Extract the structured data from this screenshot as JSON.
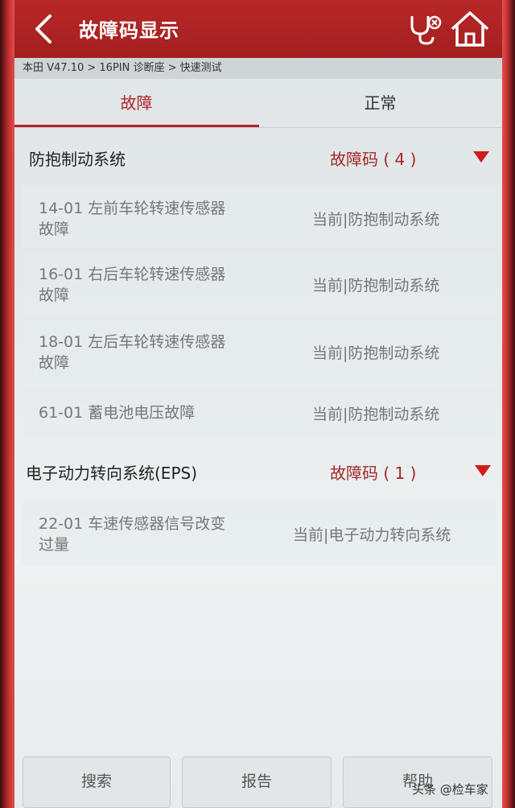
{
  "header": {
    "title": "故障码显示",
    "back_icon": "chevron-left-icon",
    "stethoscope_icon": "stethoscope-icon",
    "home_icon": "home-icon"
  },
  "breadcrumb": "本田 V47.10 > 16PIN 诊断座 > 快速测试",
  "tabs": [
    {
      "label": "故障",
      "active": true
    },
    {
      "label": "正常",
      "active": false
    }
  ],
  "groups": [
    {
      "title": "防抱制动系统",
      "count_label": "故障码 ( 4 )",
      "items": [
        {
          "line1": "14-01 左前车轮转速传感器",
          "line2": "故障",
          "status": "当前|防抱制动系统"
        },
        {
          "line1": "16-01 右后车轮转速传感器",
          "line2": "故障",
          "status": "当前|防抱制动系统"
        },
        {
          "line1": "18-01 左后车轮转速传感器",
          "line2": "故障",
          "status": "当前|防抱制动系统"
        },
        {
          "line1": "61-01 蓄电池电压故障",
          "line2": "",
          "status": "当前|防抱制动系统"
        }
      ]
    },
    {
      "title": "电子动力转向系统(EPS)",
      "count_label": "故障码 ( 1 )",
      "items": [
        {
          "line1": "22-01 车速传感器信号改变",
          "line2": "过量",
          "status": "当前|电子动力转向系统"
        }
      ]
    }
  ],
  "footer": {
    "search": "搜索",
    "report": "报告",
    "help": "帮助"
  },
  "watermark": "头条 @检车家",
  "colors": {
    "header_red": "#b82828",
    "accent_red": "#b32626",
    "triangle_red": "#d21c1c"
  }
}
